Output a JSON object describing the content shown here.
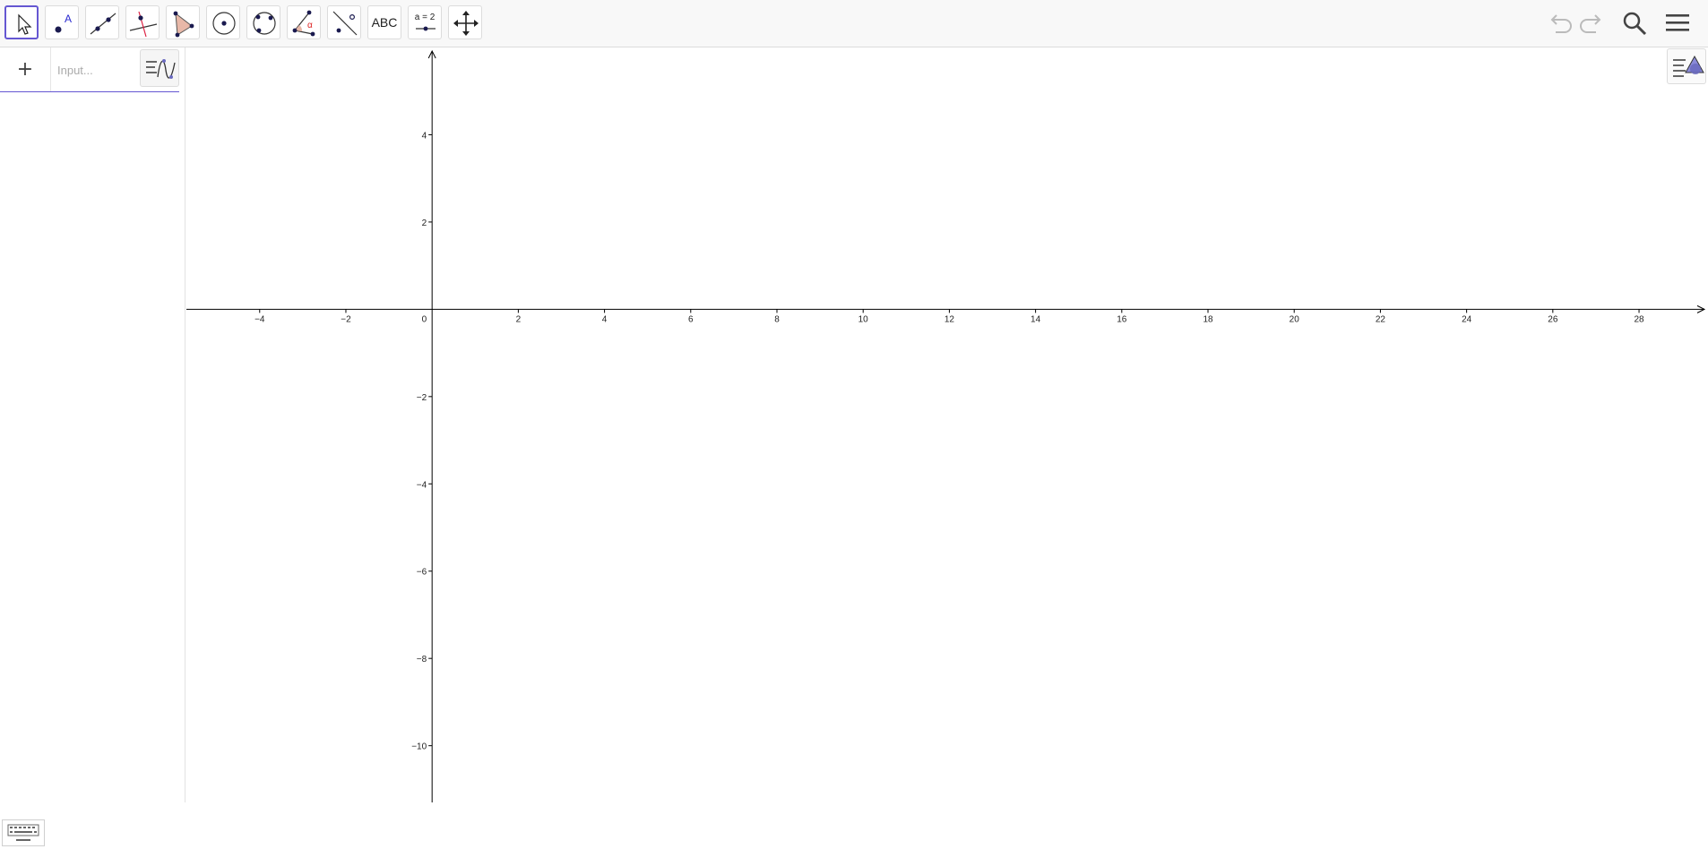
{
  "toolbar": {
    "tools": [
      {
        "name": "move-tool",
        "icon": "arrow-pointer-icon",
        "active": true
      },
      {
        "name": "point-tool",
        "icon": "point-icon",
        "label": "A"
      },
      {
        "name": "line-tool",
        "icon": "line-through-two-points-icon"
      },
      {
        "name": "perpendicular-line-tool",
        "icon": "perpendicular-line-icon"
      },
      {
        "name": "polygon-tool",
        "icon": "polygon-icon"
      },
      {
        "name": "circle-center-point-tool",
        "icon": "circle-center-icon"
      },
      {
        "name": "circle-three-points-tool",
        "icon": "circle-three-points-icon"
      },
      {
        "name": "angle-tool",
        "icon": "angle-icon",
        "label": "α"
      },
      {
        "name": "reflect-about-line-tool",
        "icon": "reflect-icon"
      },
      {
        "name": "text-tool",
        "icon": "text-icon",
        "label": "ABC"
      },
      {
        "name": "slider-tool",
        "icon": "slider-icon",
        "label": "a = 2"
      },
      {
        "name": "move-graphics-view-tool",
        "icon": "move-cross-arrows-icon"
      }
    ],
    "right": [
      "undo-icon",
      "redo-icon",
      "search-icon",
      "menu-icon"
    ]
  },
  "algebra": {
    "add_label": "+",
    "input_placeholder": "Input...",
    "style_icon": "algebra-style-icon",
    "keyboard_icon": "keyboard-icon"
  },
  "graphics": {
    "style_icon": "graphics-style-icon",
    "origin_label": "0",
    "x_axis": {
      "min": -5.7,
      "max": 29.6,
      "ticks": [
        -4,
        -2,
        2,
        4,
        6,
        8,
        10,
        12,
        14,
        16,
        18,
        20,
        22,
        24,
        26,
        28
      ]
    },
    "y_axis": {
      "min": -11.3,
      "max": 6.0,
      "ticks": [
        4,
        2,
        -2,
        -4,
        -6,
        -8,
        -10
      ]
    },
    "colors": {
      "accent": "#6557d2",
      "axis": "#000000"
    }
  }
}
